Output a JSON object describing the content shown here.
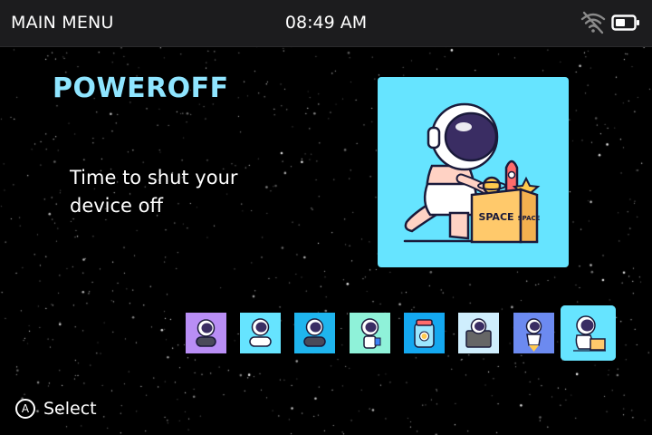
{
  "header": {
    "menu_title": "MAIN MENU",
    "clock": "08:49 AM",
    "wifi_icon": "wifi-off-icon",
    "battery_icon": "battery-half-icon"
  },
  "main": {
    "title": "POWEROFF",
    "description": "Time to shut your device off",
    "preview_icon": "astronaut-pushing-space-box",
    "preview_box_text": "SPACE",
    "preview_box_side_text": "SPACE"
  },
  "thumbnails": [
    {
      "name": "astronaut-gamepad",
      "color": "#b98ef5"
    },
    {
      "name": "astronaut-controller",
      "color": "#66e4ff"
    },
    {
      "name": "astronaut-gamepad-blue",
      "color": "#1fb5ee"
    },
    {
      "name": "astronaut-drink",
      "color": "#8ff2d9"
    },
    {
      "name": "astronaut-jar",
      "color": "#14a8f0"
    },
    {
      "name": "astronaut-tv",
      "color": "#cfeefd"
    },
    {
      "name": "astronaut-rocket",
      "color": "#6c8af0"
    },
    {
      "name": "astronaut-box",
      "color": "#66e4ff",
      "selected": true
    }
  ],
  "footer": {
    "button_glyph": "A",
    "action_label": "Select"
  },
  "colors": {
    "accent": "#8fe5ff",
    "preview_bg": "#66e4ff",
    "topbar_bg": "#1c1c1e"
  }
}
